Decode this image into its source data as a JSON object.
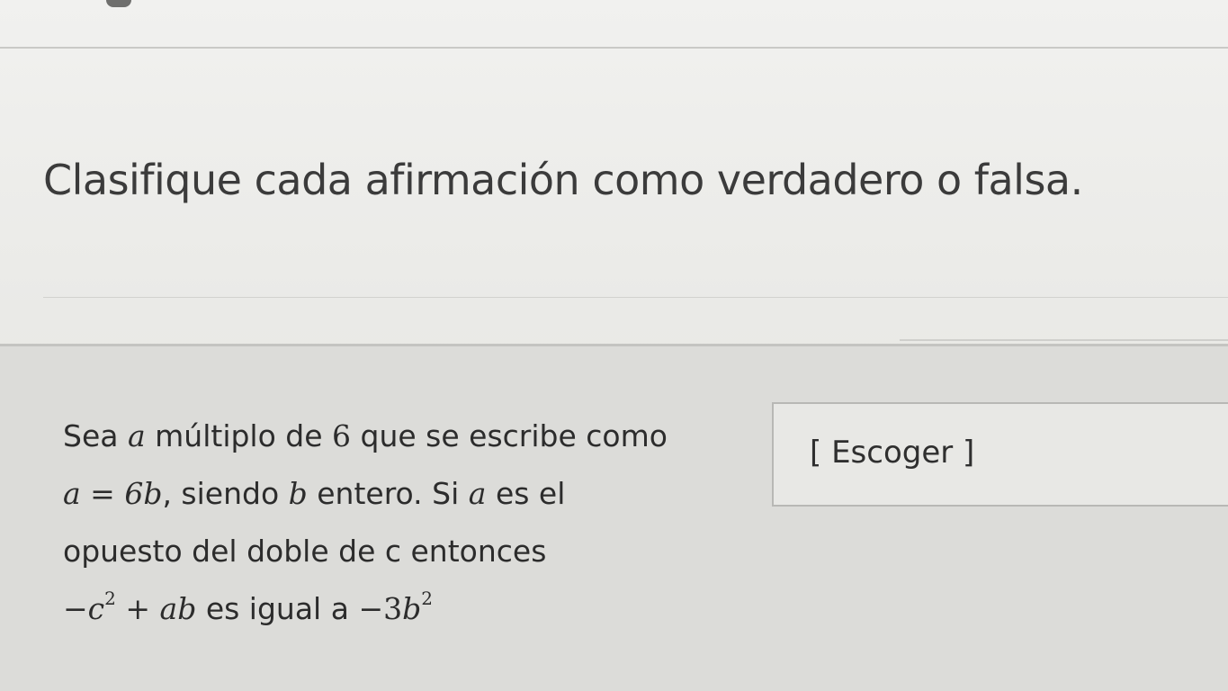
{
  "question": {
    "title": "Clasifique cada afirmación como verdadero o falsa."
  },
  "statement": {
    "line1": {
      "prefix": "Sea ",
      "var_a": "a",
      "middle": " múltiplo de ",
      "num": "6",
      "suffix": " que se escribe como"
    },
    "line2": {
      "eq_lhs": "a",
      "eq_op": " = ",
      "eq_rhs": "6b",
      "middle": ", siendo ",
      "var_b": "b",
      "suffix1": " entero. Si ",
      "var_a": "a",
      "suffix2": " es el"
    },
    "line3": {
      "text": "opuesto del doble de c entonces"
    },
    "line4": {
      "neg": "−",
      "c": "c",
      "c_exp": "2",
      "plus": " + ",
      "ab": "ab",
      "middle": " es igual a ",
      "neg2": "−",
      "coef": "3",
      "b": "b",
      "b_exp": "2"
    }
  },
  "answer": {
    "select_label": "[ Escoger ]"
  }
}
